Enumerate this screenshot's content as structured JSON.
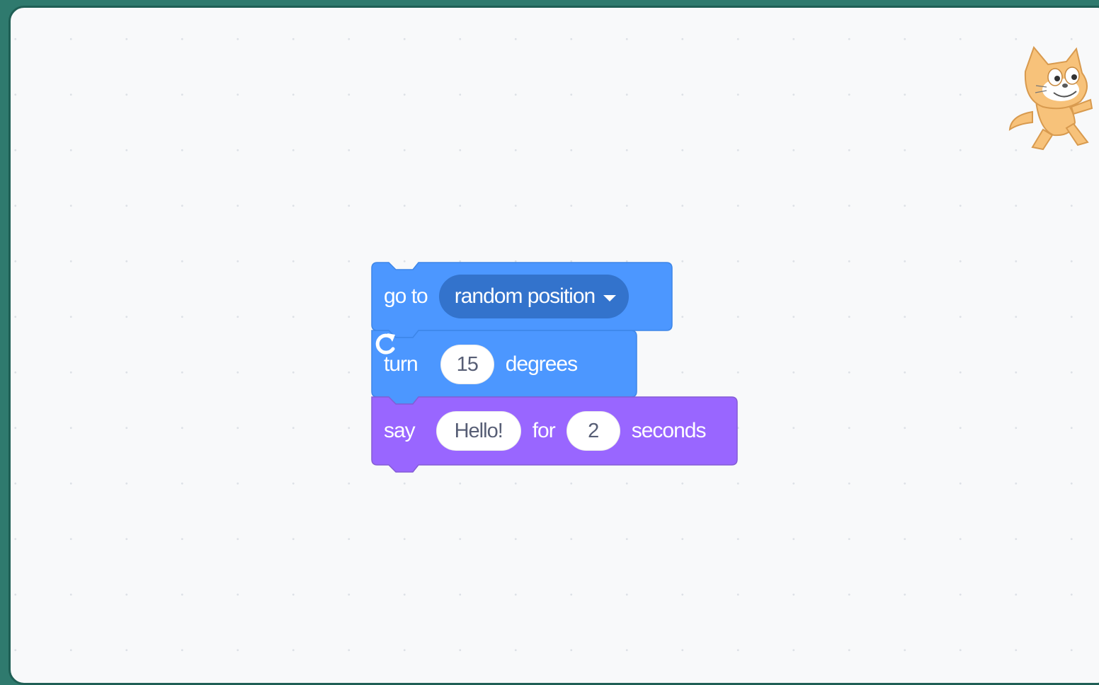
{
  "blocks": {
    "goto": {
      "label": "go to",
      "menu_value": "random position",
      "menu_icon": "dropdown-caret-icon",
      "color": "#4c97ff"
    },
    "turn": {
      "label": "turn",
      "icon": "rotate-clockwise-icon",
      "value": "15",
      "suffix": "degrees",
      "color": "#4c97ff"
    },
    "say": {
      "label": "say",
      "message": "Hello!",
      "for_label": "for",
      "seconds_value": "2",
      "seconds_label": "seconds",
      "color": "#9966ff"
    }
  },
  "sprite": {
    "name": "scratch-cat",
    "icon": "cat-sprite-icon"
  },
  "colors": {
    "motion": "#4c97ff",
    "looks": "#9966ff",
    "menu_fill": "#3373cc",
    "workspace": "#f8f9fa",
    "frame": "#2f7a6e"
  }
}
